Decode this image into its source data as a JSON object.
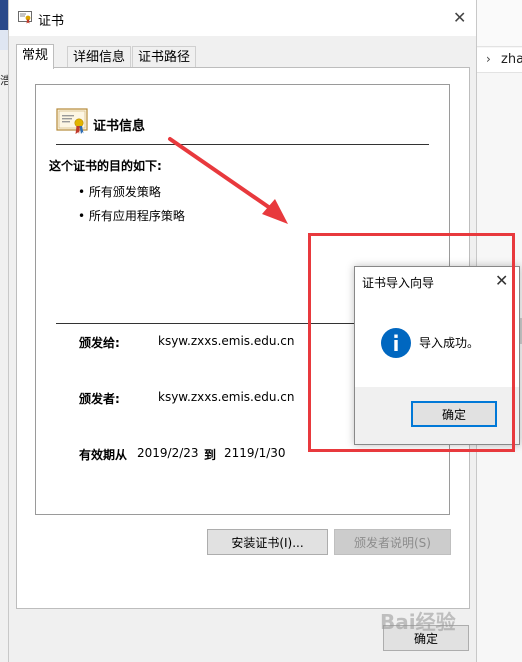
{
  "background": {
    "left_glyph": "浩",
    "right_breadcrumb": "zha"
  },
  "window": {
    "title": "证书",
    "tabs": [
      {
        "label": "常规",
        "active": true
      },
      {
        "label": "详细信息",
        "active": false
      },
      {
        "label": "证书路径",
        "active": false
      }
    ],
    "info": {
      "heading": "证书信息",
      "purpose_title": "这个证书的目的如下:",
      "purposes": [
        "所有颁发策略",
        "所有应用程序策略"
      ],
      "issued_to_label": "颁发给:",
      "issued_to_value": "ksyw.zxxs.emis.edu.cn",
      "issued_by_label": "颁发者:",
      "issued_by_value": "ksyw.zxxs.emis.edu.cn",
      "validity_from_label": "有效期从",
      "validity_from": "2019/2/23",
      "validity_to_label": "到",
      "validity_to": "2119/1/30"
    },
    "buttons": {
      "install_cert": "安装证书(I)...",
      "issuer_statement": "颁发者说明(S)",
      "ok": "确定"
    }
  },
  "popup": {
    "title": "证书导入向导",
    "message": "导入成功。",
    "ok": "确定"
  },
  "watermark": "Bai经验",
  "colors": {
    "accent": "#0078d7",
    "annotation": "#e8393d"
  }
}
